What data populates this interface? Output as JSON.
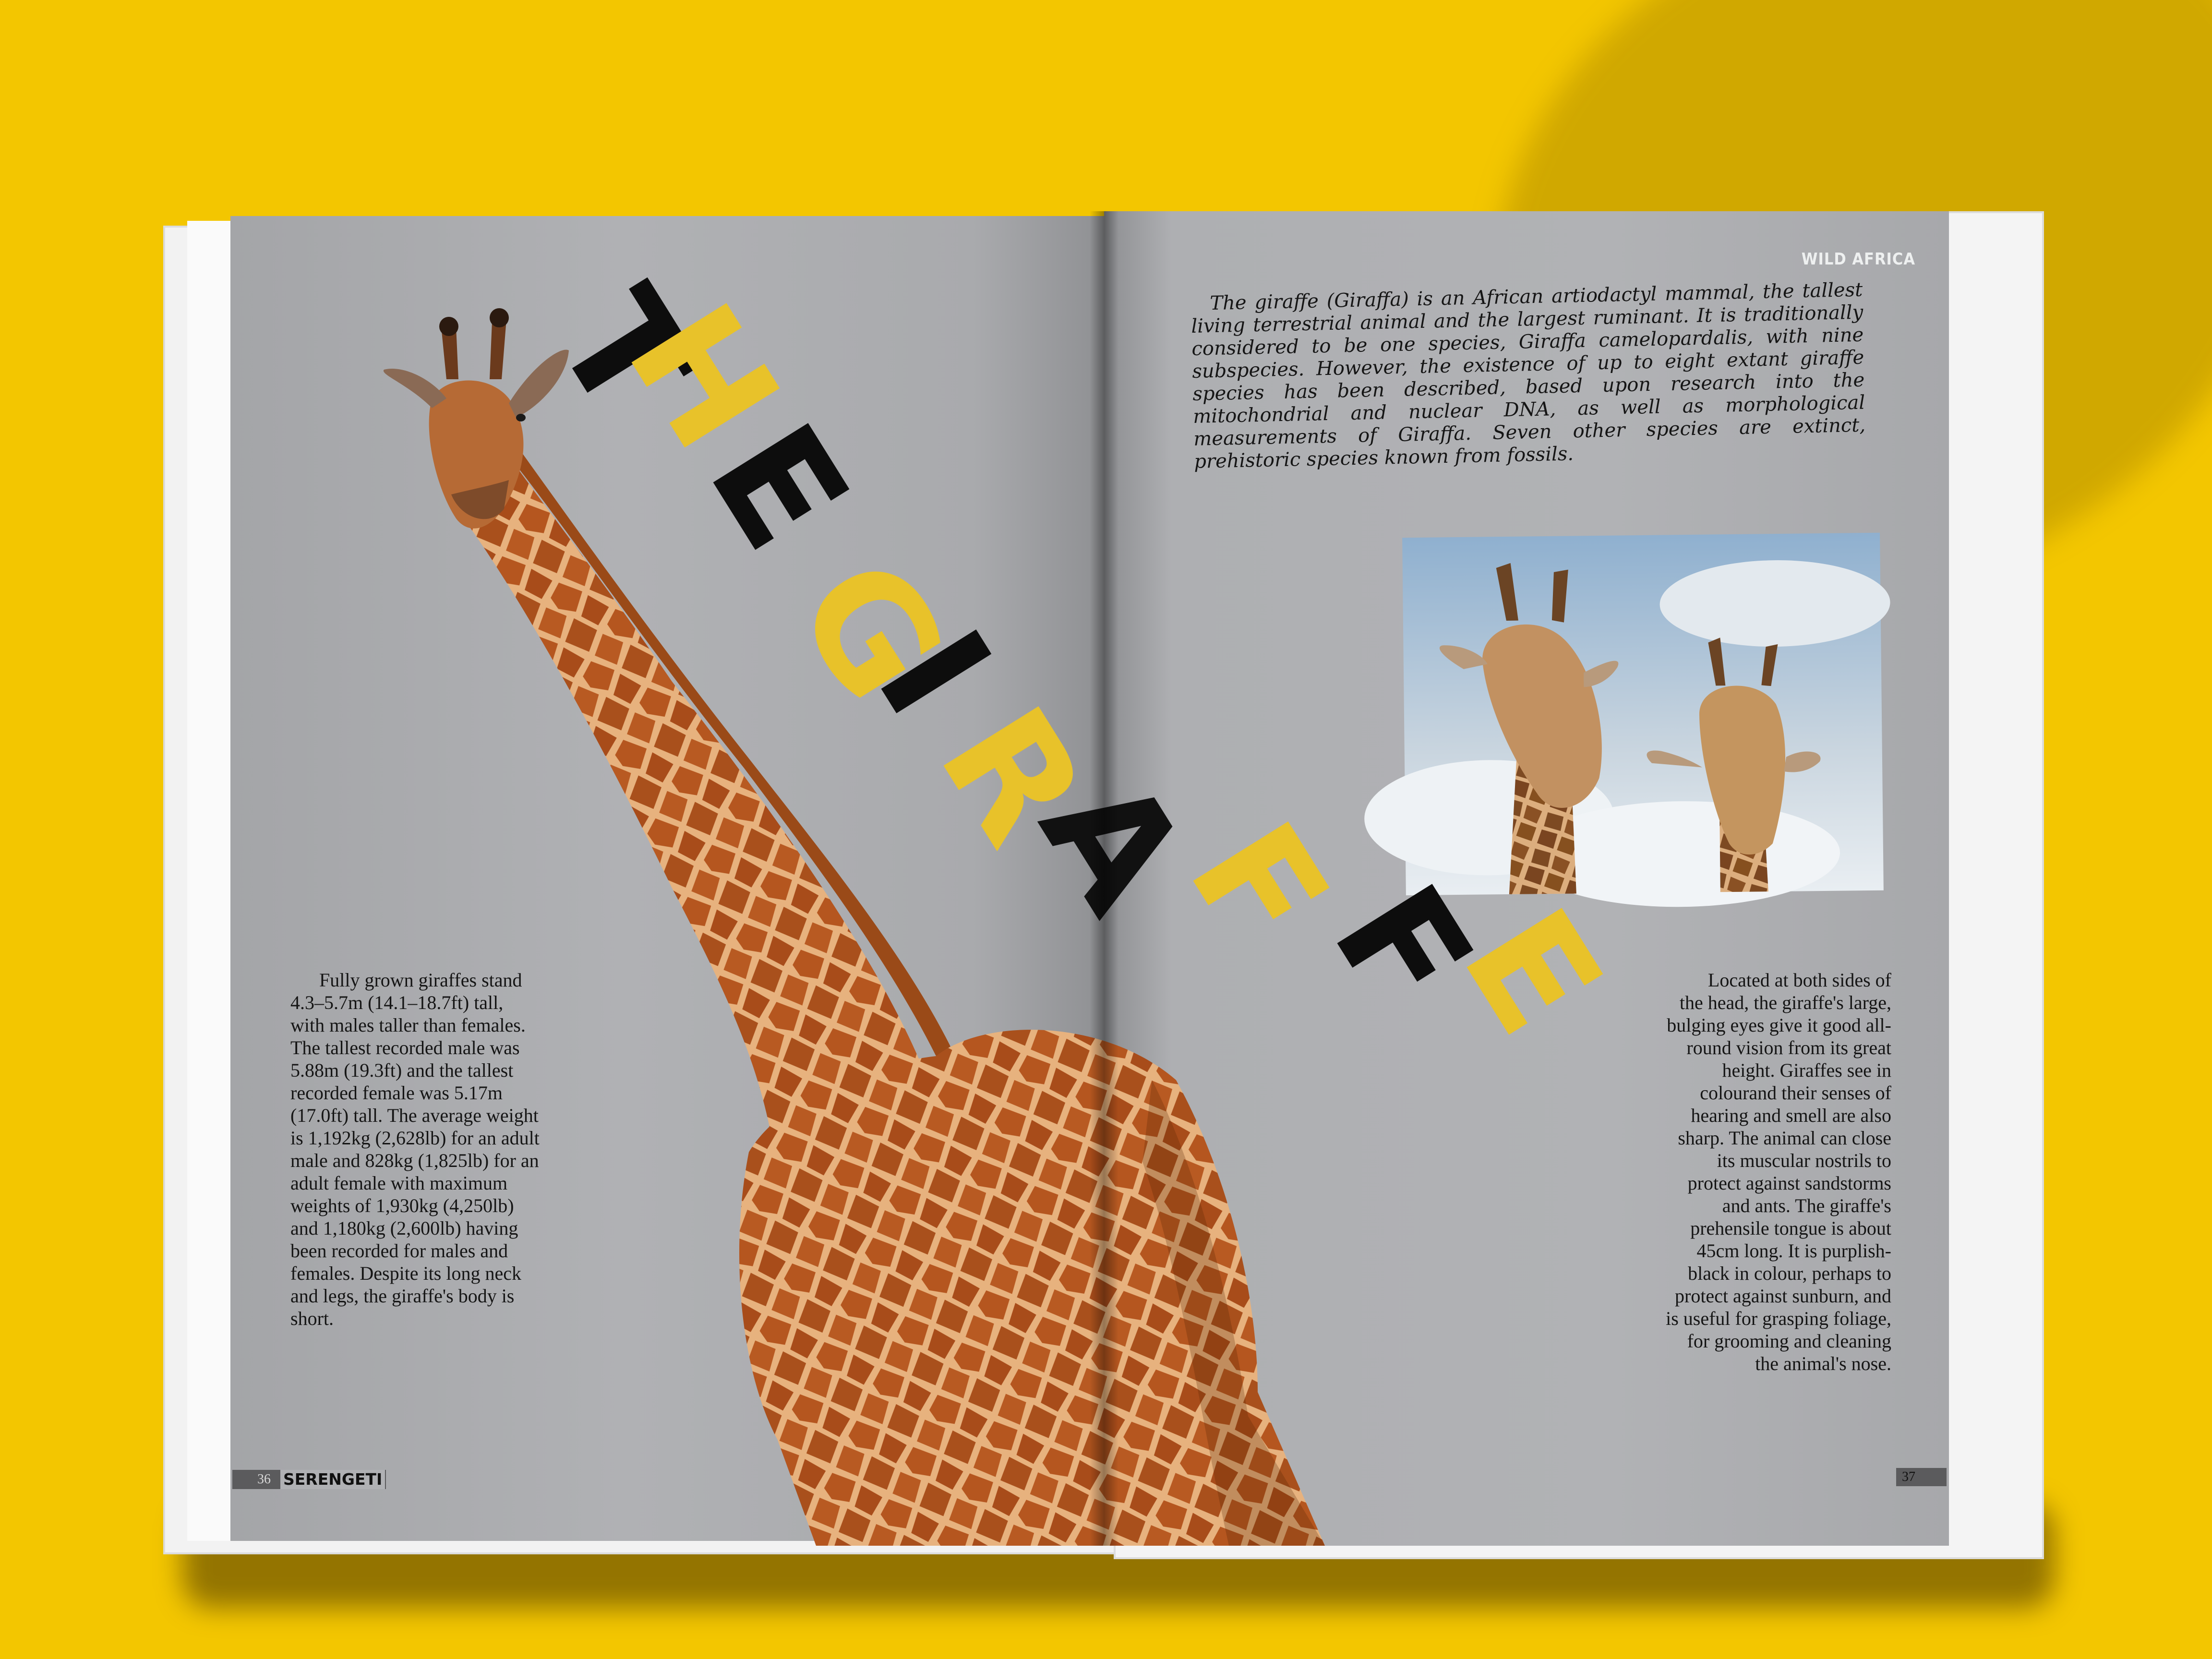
{
  "magazine": {
    "section_label": "WILD AFRICA",
    "title_letters": [
      "T",
      "H",
      "E",
      "G",
      "I",
      "R",
      "A",
      "F",
      "F",
      "E"
    ],
    "intro_text": "The giraffe (Giraffa) is an African artiodactyl mammal, the tallest living terrestrial animal and the largest ruminant. It is traditionally considered to be one species, Giraffa camelopardalis, with nine subspecies. However, the existence of up to eight extant giraffe species has been described, based upon research into the mitochondrial and nuclear DNA, as well as morphological measurements of Giraffa. Seven other species are extinct, prehistoric species known from fossils.",
    "left_column_text": "Fully grown giraffes stand 4.3–5.7m (14.1–18.7ft) tall, with males taller than females. The tallest recorded male was 5.88m (19.3ft) and the tallest recorded female was 5.17m (17.0ft) tall. The average weight is 1,192kg (2,628lb) for an adult male and 828kg (1,825lb) for an adult female with maximum weights of 1,930kg (4,250lb) and 1,180kg (2,600lb) having been recorded for males and females. Despite its long neck and legs, the giraffe's body is short.",
    "right_column_text": "Located at both sides of the head, the giraffe's large, bulging eyes give it good all-round vision from its great height. Giraffes see in colourand their senses of hearing and smell are also sharp. The animal can close its muscular nostrils to protect against sandstorms and ants. The giraffe's prehensile tongue is about 45cm long. It is purplish-black in colour, perhaps to protect against sunburn, and is useful for grasping foliage, for grooming and cleaning the animal's nose.",
    "left_page_number": "36",
    "brand": "SERENGETI",
    "right_page_number": "37"
  },
  "colors": {
    "background": "#f3c600",
    "page": "#a9aaad",
    "title_yellow": "#e8c22a",
    "title_black": "#0d0d0d"
  }
}
